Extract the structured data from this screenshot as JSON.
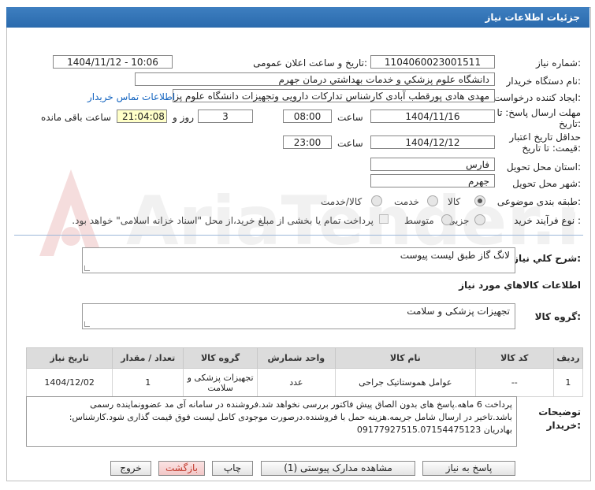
{
  "window": {
    "title": "جزئیات اطلاعات نیاز"
  },
  "labels": {
    "need_number": "شماره نیاز:",
    "announce_datetime": "تاریخ و ساعت اعلان عمومی:",
    "buyer_org": "نام دستگاه خریدار:",
    "requester": "ایجاد کننده درخواست:",
    "reply_deadline_line1": "مهلت ارسال پاسخ: تا",
    "reply_deadline_line2": "تاریخ:",
    "min_validity_line1": "حداقل تاریخ اعتبار",
    "min_validity_line2": "قیمت: تا تاریخ:",
    "time": "ساعت",
    "day_and": "روز و",
    "hours_remaining": "ساعت باقی مانده",
    "delivery_province": "استان محل تحویل:",
    "delivery_city": "شهر محل تحویل:",
    "subject_category": "طبقه بندی موضوعی:",
    "process_type": "نوع فرآیند خرید :",
    "general_description": "شرح کلي نياز:",
    "goods_info": "اطلاعات کالاهاي مورد نياز",
    "goods_group": "گروه کالا:",
    "buyer_notes_line1": "توضیحات",
    "buyer_notes_line2": "خریدار:"
  },
  "fields": {
    "need_number": "1104060023001511",
    "announce_datetime": "1404/11/12 - 10:06",
    "buyer_org": "دانشگاه علوم پزشکي و خدمات بهداشتي  درمان جهرم",
    "requester": "مهدی هادی پورقطب آبادی کارشناس تدارکات دارویی وتجهیزات دانشگاه علوم پزشکی",
    "contact_link": "اطلاعات تماس خریدار",
    "reply_date": "1404/11/16",
    "reply_time": "08:00",
    "days_remaining": "3",
    "time_remaining": "21:04:08",
    "validity_date": "1404/12/12",
    "validity_time": "23:00",
    "province": "فارس",
    "city": "جهرم",
    "general_description": "لانگ گاز طبق لیست پیوست",
    "goods_group": "تجهیزات پزشکی و سلامت"
  },
  "subject_options": [
    {
      "label": "کالا",
      "selected": true
    },
    {
      "label": "خدمت",
      "selected": false
    },
    {
      "label": "کالا/خدمت",
      "selected": false
    }
  ],
  "process_options": [
    {
      "label": "جزیی",
      "selected": false
    },
    {
      "label": "متوسط",
      "selected": false
    }
  ],
  "treasury_checkbox_label": "پرداخت تمام یا بخشی از مبلغ خرید،از محل \"اسناد خزانه اسلامی\" خواهد بود.",
  "table": {
    "headers": [
      "ردیف",
      "کد کالا",
      "نام کالا",
      "واحد شمارش",
      "گروه کالا",
      "تعداد / مقدار",
      "تاریخ نیاز"
    ],
    "rows": [
      [
        "1",
        "--",
        "عوامل هموستاتیک جراحی",
        "عدد",
        "تجهیزات پزشکی و سلامت",
        "1",
        "1404/12/02"
      ]
    ]
  },
  "buyer_notes": {
    "line1": "پرداخت 6 ماهه.پاسخ های بدون الصاق پیش فاکتور بررسی نخواهد شد.فروشنده در سامانه آی مد عضوونماینده رسمی",
    "line2": "باشد.تاخیر در ارسال شامل جریمه.هزینه حمل با فروشنده.درصورت موجودی کامل لیست فوق قیمت گذاری شود.کارشناس:",
    "line3": "بهادریان 09177927515.07154475123"
  },
  "buttons": {
    "reply": "پاسخ به نیاز",
    "attachments": "مشاهده مدارک پیوستی (1)",
    "print": "چاپ",
    "back": "بازگشت",
    "exit": "خروج"
  },
  "colors": {
    "title_bar": "#2f72b6",
    "link": "#1565c0",
    "time_highlight": "#ffffc8",
    "back_button_text": "#c0392b"
  },
  "watermark_text": "AriaTender.neT"
}
